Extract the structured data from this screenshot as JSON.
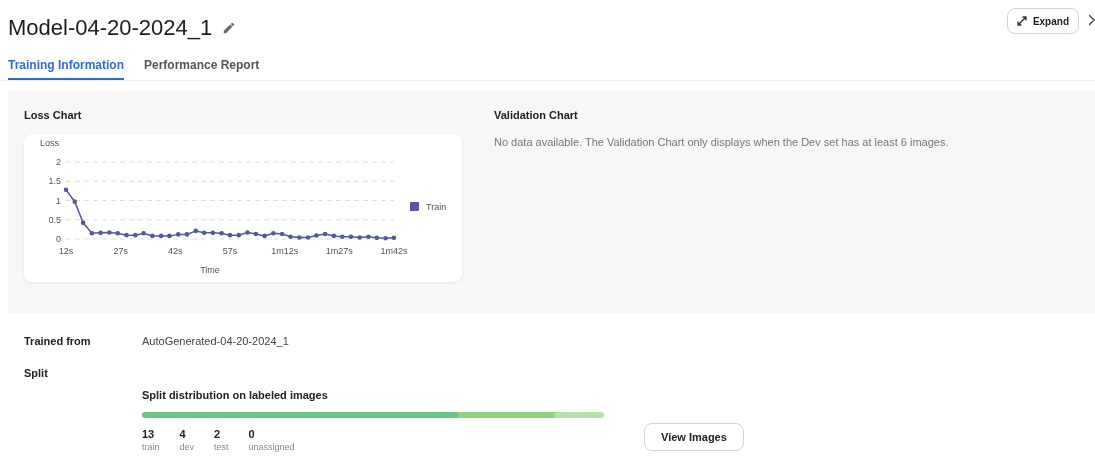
{
  "header": {
    "title": "Model-04-20-2024_1",
    "expand_button": "Expand"
  },
  "tabs": [
    {
      "label": "Training Information",
      "selected": true
    },
    {
      "label": "Performance Report",
      "selected": false
    }
  ],
  "loss_chart": {
    "title": "Loss Chart",
    "chart_data": {
      "type": "line",
      "grid": true,
      "xlim": [
        12,
        102
      ],
      "xlabel": "Time",
      "ylabel": "Loss",
      "ylim": [
        0,
        2
      ],
      "yticks": [
        0,
        {
          "value": 0.5,
          "label": "0.5"
        },
        1,
        {
          "value": 1.5,
          "label": "1.5"
        },
        2
      ],
      "xticks": [
        {
          "value": 12,
          "label": "12s"
        },
        {
          "value": 27,
          "label": "27s"
        },
        {
          "value": 42,
          "label": "42s"
        },
        {
          "value": 57,
          "label": "57s"
        },
        {
          "value": 72,
          "label": "1m12s"
        },
        {
          "value": 87,
          "label": "1m27s"
        },
        {
          "value": 102,
          "label": "1m42s"
        }
      ],
      "x": [
        12,
        14.4,
        16.7,
        19.1,
        21.5,
        23.9,
        26.2,
        28.6,
        31,
        33.3,
        35.7,
        38.1,
        40.4,
        42.8,
        45.2,
        47.6,
        49.9,
        52.3,
        54.7,
        57,
        59.4,
        61.8,
        64.1,
        66.5,
        68.9,
        71.3,
        73.6,
        76,
        78.4,
        80.7,
        83.1,
        85.5,
        87.8,
        90.2,
        92.6,
        95,
        97.3,
        99.7,
        102
      ],
      "series": [
        {
          "name": "Train",
          "color": "#5458a0",
          "values": [
            1.28,
            0.97,
            0.42,
            0.15,
            0.16,
            0.17,
            0.15,
            0.1,
            0.1,
            0.15,
            0.08,
            0.08,
            0.08,
            0.12,
            0.12,
            0.21,
            0.16,
            0.16,
            0.15,
            0.1,
            0.1,
            0.17,
            0.13,
            0.08,
            0.15,
            0.13,
            0.06,
            0.04,
            0.04,
            0.09,
            0.13,
            0.08,
            0.06,
            0.06,
            0.04,
            0.06,
            0.03,
            0.02,
            0.03
          ]
        }
      ]
    }
  },
  "validation_chart": {
    "title": "Validation Chart",
    "message": "No data available. The Validation Chart only displays when the Dev set has at least 6 images."
  },
  "details": [
    {
      "label": "Trained from",
      "value": "AutoGenerated-04-20-2024_1"
    },
    {
      "label": "Split"
    }
  ],
  "split": {
    "title": "Split distribution on labeled images",
    "button": "View Images",
    "segments": [
      {
        "count": "13",
        "label": "train",
        "color": "#6cc485"
      },
      {
        "count": "4",
        "label": "dev",
        "color": "#90d27f"
      },
      {
        "count": "2",
        "label": "test",
        "color": "#b5e2a8"
      },
      {
        "count": "0",
        "label": "unassigned"
      }
    ]
  }
}
